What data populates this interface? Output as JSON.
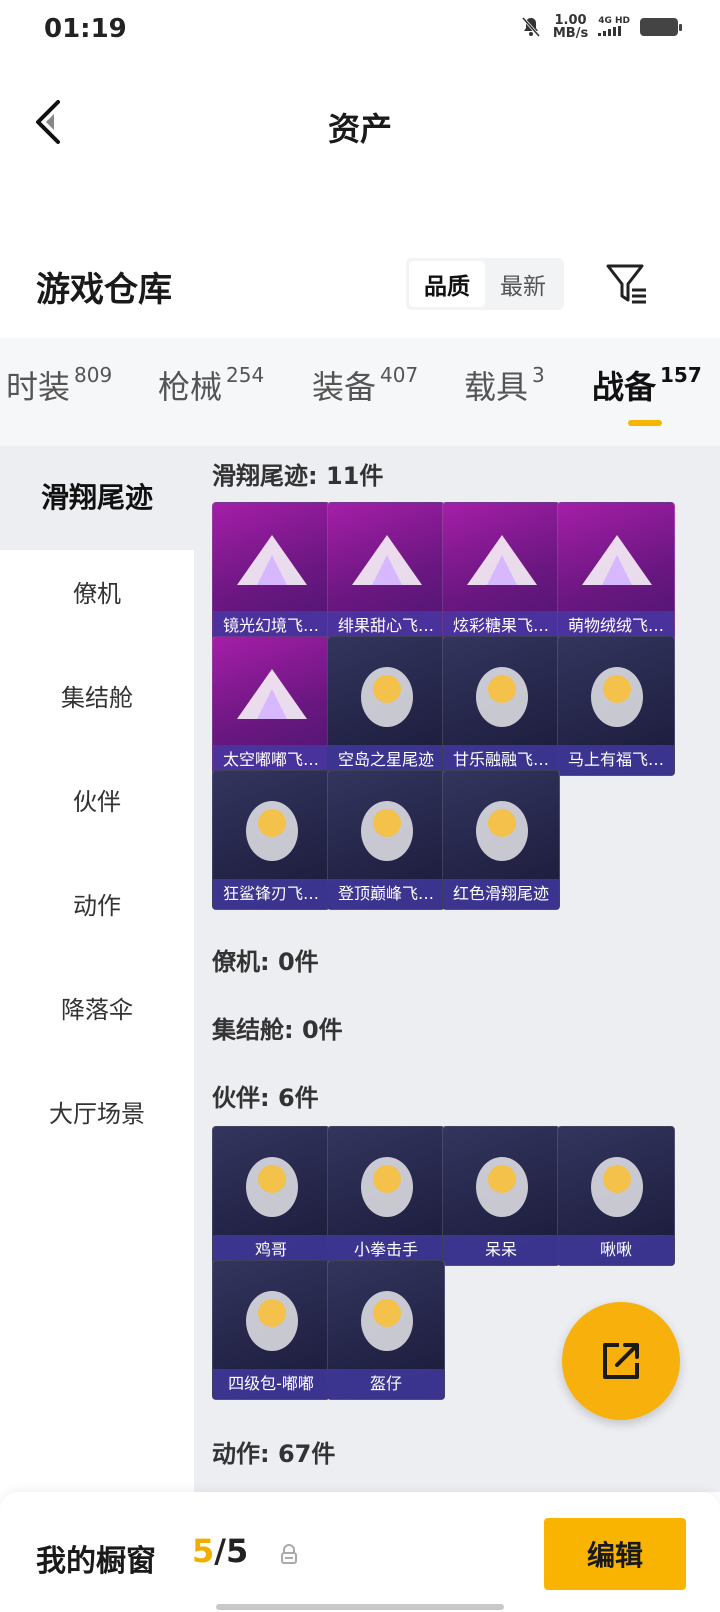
{
  "status_bar": {
    "time": "01:19",
    "speed_value": "1.00",
    "speed_unit": "MB/s",
    "network_top": "4G HD",
    "network_bottom": ""
  },
  "header": {
    "title": "资产",
    "back_icon": "chevron-left-icon"
  },
  "warehouse": {
    "title": "游戏仓库",
    "sort_options": [
      "品质",
      "最新"
    ],
    "sort_selected": "品质",
    "filter_icon": "filter-icon"
  },
  "category_tabs": [
    {
      "label": "时装",
      "count": "809"
    },
    {
      "label": "枪械",
      "count": "254"
    },
    {
      "label": "装备",
      "count": "407"
    },
    {
      "label": "载具",
      "count": "3"
    },
    {
      "label": "战备",
      "count": "157",
      "active": true
    }
  ],
  "sidebar": {
    "items": [
      {
        "label": "滑翔尾迹",
        "active": true
      },
      {
        "label": "僚机"
      },
      {
        "label": "集结舱"
      },
      {
        "label": "伙伴"
      },
      {
        "label": "动作"
      },
      {
        "label": "降落伞"
      },
      {
        "label": "大厅场景"
      }
    ]
  },
  "sections": [
    {
      "title": "滑翔尾迹: 11件",
      "items": [
        {
          "name": "镜光幻境飞…",
          "tier": "purple",
          "icon": "crystal-wing-icon"
        },
        {
          "name": "绯果甜心飞…",
          "tier": "purple",
          "icon": "fruit-fairy-icon"
        },
        {
          "name": "炫彩糖果飞…",
          "tier": "purple",
          "icon": "candy-icon"
        },
        {
          "name": "萌物绒绒飞…",
          "tier": "purple",
          "icon": "bunny-icon"
        },
        {
          "name": "太空嘟嘟飞…",
          "tier": "purple",
          "icon": "ufo-icon"
        },
        {
          "name": "空岛之星尾迹",
          "tier": "blue",
          "icon": "rainbow-trail-icon"
        },
        {
          "name": "甘乐融融飞…",
          "tier": "blue",
          "icon": "penguin-icon"
        },
        {
          "name": "马上有福飞…",
          "tier": "blue",
          "icon": "horse-icon"
        },
        {
          "name": "狂鲨锋刃飞…",
          "tier": "blue",
          "icon": "shark-icon"
        },
        {
          "name": "登顶巅峰飞…",
          "tier": "blue",
          "icon": "jet-icon"
        },
        {
          "name": "红色滑翔尾迹",
          "tier": "blue",
          "icon": "red-trail-icon"
        }
      ]
    },
    {
      "title": "僚机: 0件",
      "items": []
    },
    {
      "title": "集结舱: 0件",
      "items": []
    },
    {
      "title": "伙伴: 6件",
      "items": [
        {
          "name": "鸡哥",
          "tier": "blue",
          "icon": "chicken-icon"
        },
        {
          "name": "小拳击手",
          "tier": "blue",
          "icon": "boxer-icon"
        },
        {
          "name": "呆呆",
          "tier": "blue",
          "icon": "chick-icon"
        },
        {
          "name": "啾啾",
          "tier": "blue",
          "icon": "pink-bird-icon"
        },
        {
          "name": "四级包-嘟嘟",
          "tier": "blue",
          "icon": "robot-bunny-icon"
        },
        {
          "name": "盔仔",
          "tier": "blue",
          "icon": "helmet-chick-icon"
        }
      ]
    },
    {
      "title": "动作: 67件",
      "items": []
    }
  ],
  "bottom": {
    "showcase_label": "我的橱窗",
    "showcase_current": "5",
    "showcase_total": "/5",
    "edit_label": "编辑"
  },
  "colors": {
    "accent": "#f8b400",
    "purple_tier": "#8a1c95",
    "blue_tier": "#2a2b52"
  }
}
